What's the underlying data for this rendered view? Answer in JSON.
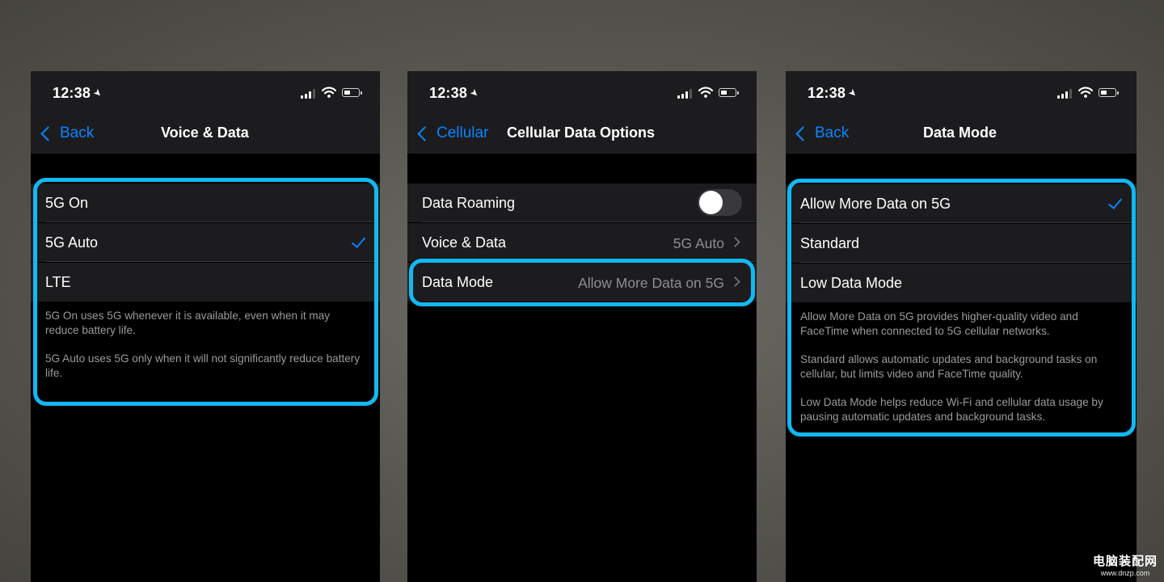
{
  "status": {
    "time": "12:38"
  },
  "screens": [
    {
      "nav": {
        "back_label": "Back",
        "title": "Voice & Data"
      },
      "options": [
        {
          "label": "5G On",
          "selected": false
        },
        {
          "label": "5G Auto",
          "selected": true
        },
        {
          "label": "LTE",
          "selected": false
        }
      ],
      "footer": [
        "5G On uses 5G whenever it is available, even when it may reduce battery life.",
        "5G Auto uses 5G only when it will not significantly reduce battery life."
      ]
    },
    {
      "nav": {
        "back_label": "Cellular",
        "title": "Cellular Data Options"
      },
      "rows": [
        {
          "label": "Data Roaming",
          "toggle_on": false
        },
        {
          "label": "Voice & Data",
          "value": "5G Auto"
        },
        {
          "label": "Data Mode",
          "value": "Allow More Data on 5G"
        }
      ]
    },
    {
      "nav": {
        "back_label": "Back",
        "title": "Data Mode"
      },
      "options": [
        {
          "label": "Allow More Data on 5G",
          "selected": true
        },
        {
          "label": "Standard",
          "selected": false
        },
        {
          "label": "Low Data Mode",
          "selected": false
        }
      ],
      "footer": [
        "Allow More Data on 5G provides higher-quality video and FaceTime when connected to 5G cellular networks.",
        "Standard allows automatic updates and background tasks on cellular, but limits video and FaceTime quality.",
        "Low Data Mode helps reduce Wi-Fi and cellular data usage by pausing automatic updates and background tasks."
      ]
    }
  ],
  "colors": {
    "accent": "#0a84ff",
    "highlight": "#12b8f2",
    "group_bg": "#1c1c1e",
    "secondary_text": "#8e8e93"
  },
  "watermark": {
    "chinese": "电脑装配网",
    "url": "www.dnzp.com"
  }
}
